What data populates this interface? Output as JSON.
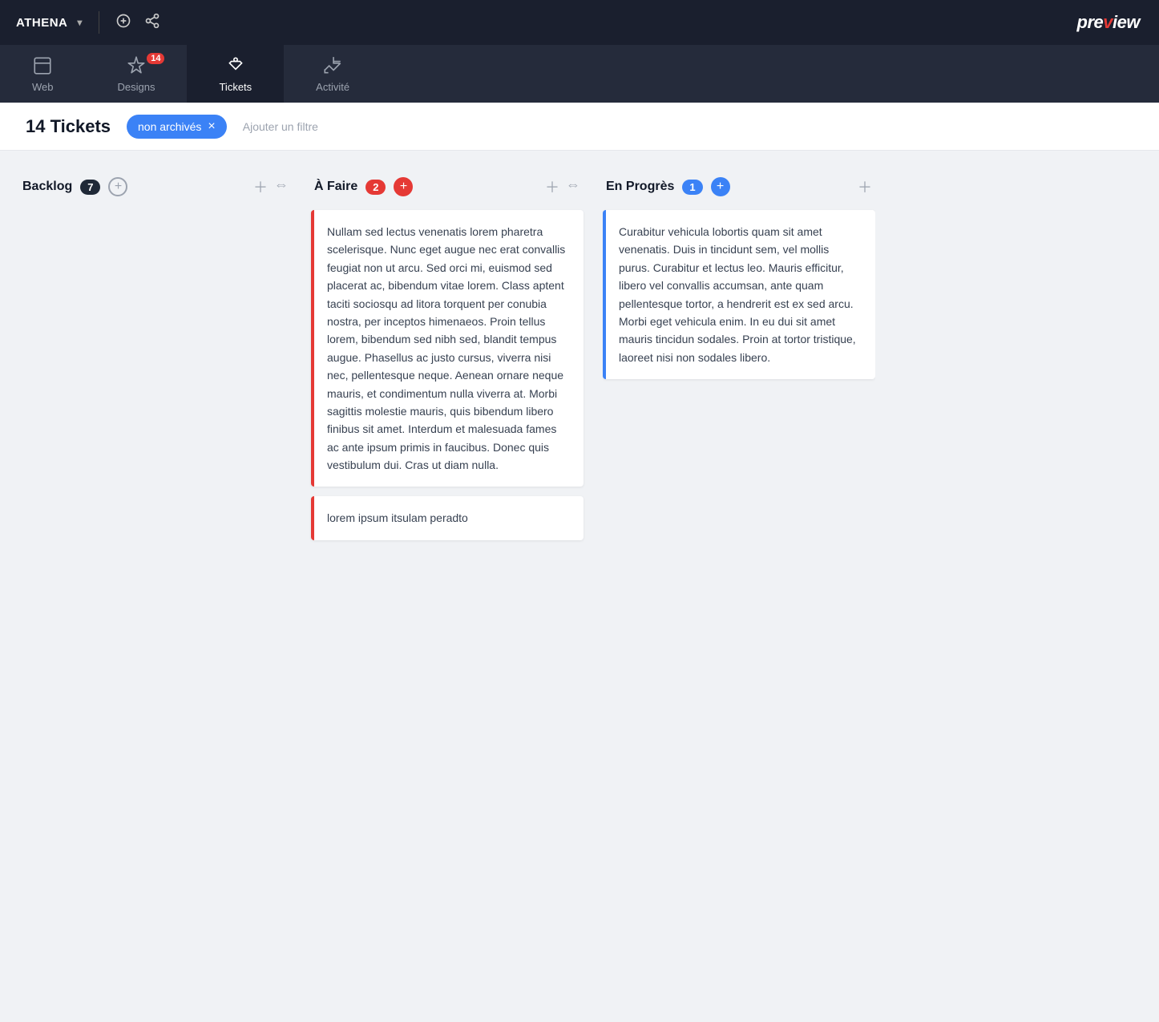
{
  "app": {
    "name": "ATHENA",
    "logo": "preview"
  },
  "navbar": {
    "items": [
      {
        "id": "web",
        "label": "Web",
        "badge": null,
        "active": false
      },
      {
        "id": "designs",
        "label": "Designs",
        "badge": "14",
        "active": false
      },
      {
        "id": "tickets",
        "label": "Tickets",
        "badge": null,
        "active": true
      },
      {
        "id": "activite",
        "label": "Activité",
        "badge": null,
        "active": false
      }
    ]
  },
  "page": {
    "title": "14 Tickets",
    "filter_label": "non archivés",
    "add_filter_label": "Ajouter un filtre"
  },
  "columns": [
    {
      "id": "backlog",
      "title": "Backlog",
      "badge": "7",
      "badge_type": "dark",
      "cards": []
    },
    {
      "id": "afaire",
      "title": "À Faire",
      "badge": "2",
      "badge_type": "red",
      "cards": [
        {
          "id": "card1",
          "text": "Nullam sed lectus venenatis lorem pharetra scelerisque. Nunc eget augue nec erat convallis feugiat non ut arcu. Sed orci mi, euismod sed placerat ac, bibendum vitae lorem. Class aptent taciti sociosqu ad litora torquent per conubia nostra, per inceptos himenaeos. Proin tellus lorem, bibendum sed nibh sed, blandit tempus augue. Phasellus ac justo cursus, viverra nisi nec, pellentesque neque. Aenean ornare neque mauris, et condimentum nulla viverra at. Morbi sagittis molestie mauris, quis bibendum libero finibus sit amet. Interdum et malesuada fames ac ante ipsum primis in faucibus. Donec quis vestibulum dui. Cras ut diam nulla.",
          "border": "red"
        },
        {
          "id": "card2",
          "text": "lorem ipsum itsulam peradto",
          "border": "red"
        }
      ]
    },
    {
      "id": "enProgres",
      "title": "En Progrès",
      "badge": "1",
      "badge_type": "blue",
      "cards": [
        {
          "id": "card3",
          "text": "Curabitur vehicula lobortis quam sit amet venenatis. Duis in tincidunt sem, vel mollis purus. Curabitur et lectus leo. Mauris efficitur, libero vel convallis accumsan, ante quam pellentesque tortor, a hendrerit est ex sed arcu. Morbi eget vehicula enim. In eu dui sit amet mauris tincidun sodales. Proin at tortor tristique, laoreet nisi non sodales libero.",
          "border": "blue"
        }
      ]
    }
  ]
}
